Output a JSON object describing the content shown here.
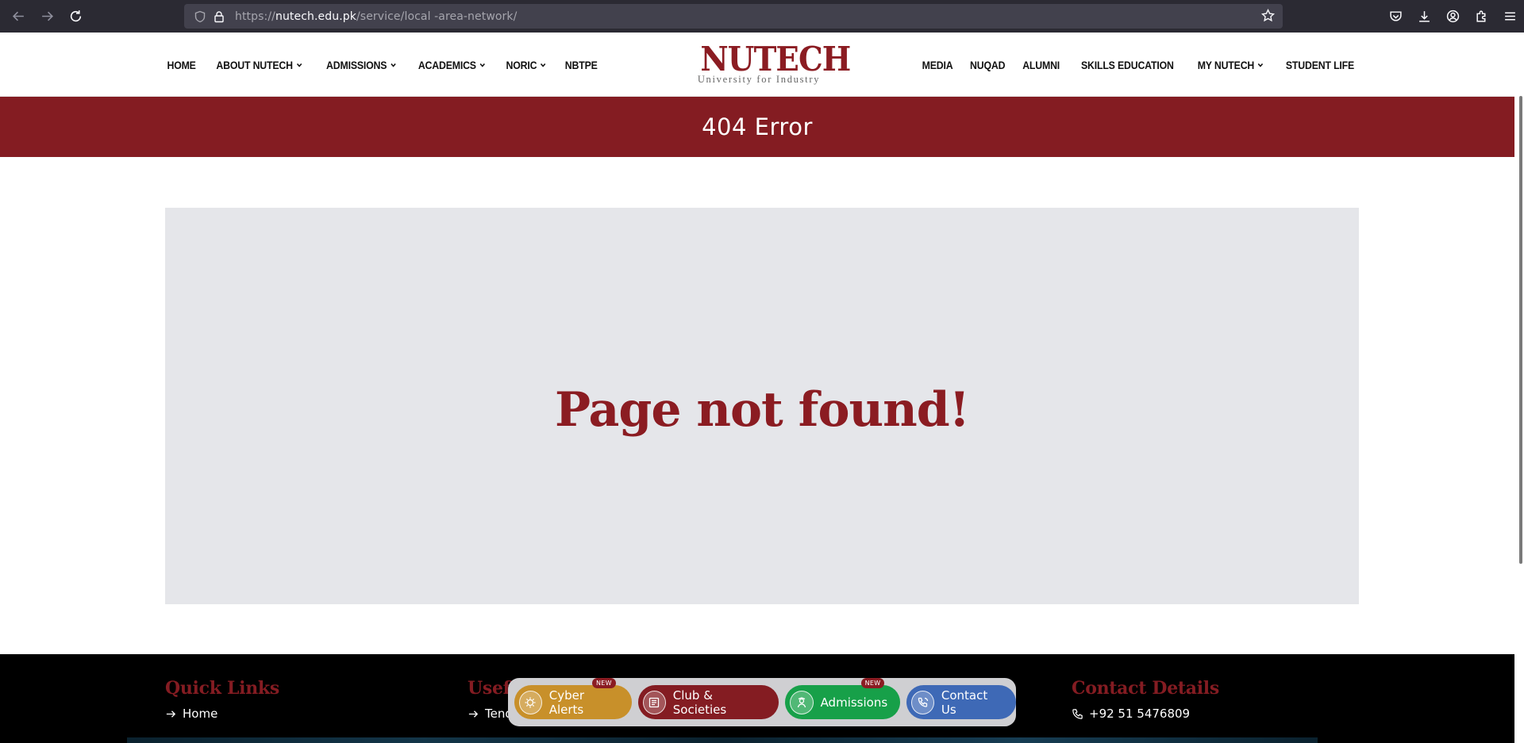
{
  "browser": {
    "url_scheme": "https://",
    "url_host": "nutech.edu.pk",
    "url_path": "/service/local -area-network/"
  },
  "logo": {
    "main": "NUTECH",
    "sub": "University for Industry"
  },
  "nav": {
    "left": [
      {
        "label": "HOME",
        "dropdown": false
      },
      {
        "label": "ABOUT NUTECH",
        "dropdown": true
      },
      {
        "label": "ADMISSIONS",
        "dropdown": true
      },
      {
        "label": "ACADEMICS",
        "dropdown": true
      },
      {
        "label": "NORIC",
        "dropdown": true
      },
      {
        "label": "NBTPE",
        "dropdown": false
      }
    ],
    "right": [
      {
        "label": "MEDIA",
        "dropdown": false
      },
      {
        "label": "NUQAD",
        "dropdown": false
      },
      {
        "label": "ALUMNI",
        "dropdown": false
      },
      {
        "label": "SKILLS EDUCATION",
        "dropdown": false
      },
      {
        "label": "MY NUTECH",
        "dropdown": true
      },
      {
        "label": "STUDENT LIFE",
        "dropdown": false
      }
    ]
  },
  "banner": {
    "title": "404 Error"
  },
  "content": {
    "message": "Page not found!"
  },
  "footer": {
    "quick_links": {
      "title": "Quick Links",
      "first": "Home"
    },
    "useful_links": {
      "title": "Usefu",
      "first": "Tende"
    },
    "contact": {
      "title": "Contact Details",
      "phone": "+92 51 5476809"
    }
  },
  "floatbar": {
    "buttons": [
      {
        "label": "Cyber Alerts",
        "badge": "NEW",
        "color": "#c8902a"
      },
      {
        "label": "Club & Societies",
        "badge": "",
        "color": "#841c22"
      },
      {
        "label": "Admissions",
        "badge": "NEW",
        "color": "#17a049"
      },
      {
        "label": "Contact Us",
        "badge": "",
        "color": "#3e69b6"
      }
    ]
  },
  "colors": {
    "brand": "#841c22",
    "banner_bg": "#841c22",
    "content_bg": "#e5e6ea",
    "footer_bg": "#000000"
  }
}
